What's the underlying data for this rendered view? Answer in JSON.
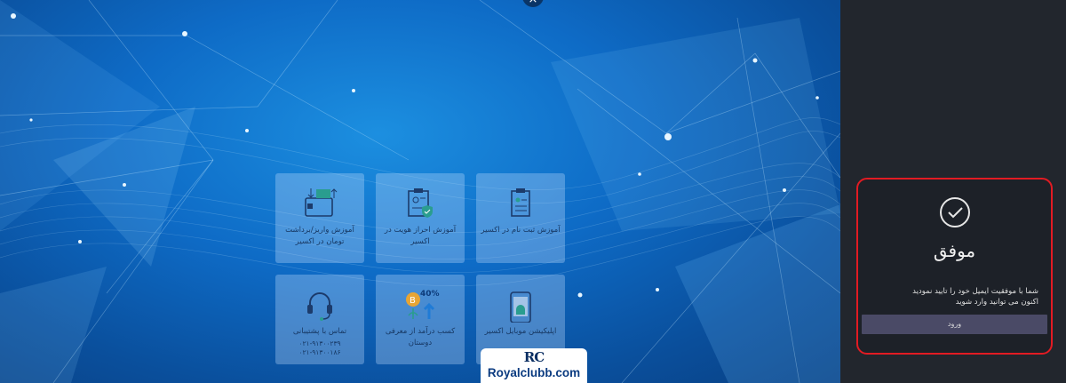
{
  "window": {
    "close_glyph": "×"
  },
  "tiles": [
    {
      "label": "آموزش ثبت نام در اکسیر",
      "icon": "registration-doc-icon"
    },
    {
      "label": "آموزش احراز هویت در اکسیر",
      "icon": "identity-verify-icon"
    },
    {
      "label": "آموزش واریز/برداشت تومان در اکسیر",
      "icon": "wallet-transfer-icon"
    },
    {
      "label": "اپلیکیشن موبایل اکسیر",
      "icon": "android-phone-icon"
    },
    {
      "label": "کسب درآمد از معرفی دوستان",
      "badge": "40%",
      "icon": "bitcoin-growth-icon"
    },
    {
      "label": "تماس با پشتیبانی",
      "phone1": "۰۲۱-۹۱۳۰۰۲۳۹",
      "phone2": "۰۲۱-۹۱۳۰۰۱۸۶",
      "icon": "headset-icon"
    }
  ],
  "dialog": {
    "icon": "checkmark-circle-icon",
    "title": "موفق",
    "message_line1": "شما با موفقیت ایمیل خود را تایید نمودید",
    "message_line2": "اکنون می توانید وارد شوید",
    "button_label": "ورود"
  },
  "watermark": {
    "logo": "RC",
    "site": "Royalclubb.com"
  },
  "colors": {
    "panel_bg": "#22262d",
    "highlight_border": "#e21b23",
    "button_bg": "#4a4a66",
    "tile_bg": "rgba(200,225,255,0.32)"
  }
}
